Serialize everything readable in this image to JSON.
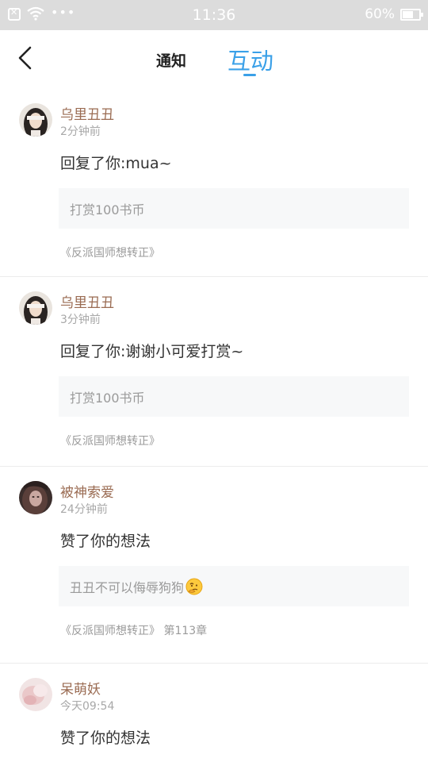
{
  "status_bar": {
    "time": "11:36",
    "battery_percent": "60%",
    "dots": "•••"
  },
  "header": {
    "tabs": [
      {
        "label": "通知",
        "active": false
      },
      {
        "label": "互动",
        "active": true
      }
    ],
    "accent_color": "#3aa0e8"
  },
  "notifications": [
    {
      "username": "乌里丑丑",
      "time": "2分钟前",
      "text": "回复了你:mua~",
      "quote": "打赏100书币",
      "source": "《反派国师想转正》"
    },
    {
      "username": "乌里丑丑",
      "time": "3分钟前",
      "text": "回复了你:谢谢小可爱打赏~",
      "quote": "打赏100书币",
      "source": "《反派国师想转正》"
    },
    {
      "username": "被神索爱",
      "time": "24分钟前",
      "text": "赞了你的想法",
      "quote": "丑丑不可以侮辱狗狗",
      "quote_emoji": "thinking-emoji",
      "source": "《反派国师想转正》 第113章"
    },
    {
      "username": "呆萌妖",
      "time": "今天09:54",
      "text": "赞了你的想法"
    }
  ],
  "colors": {
    "username": "#9a6b52",
    "muted": "#a8a8a8",
    "quote_bg": "#f7f8f9"
  }
}
